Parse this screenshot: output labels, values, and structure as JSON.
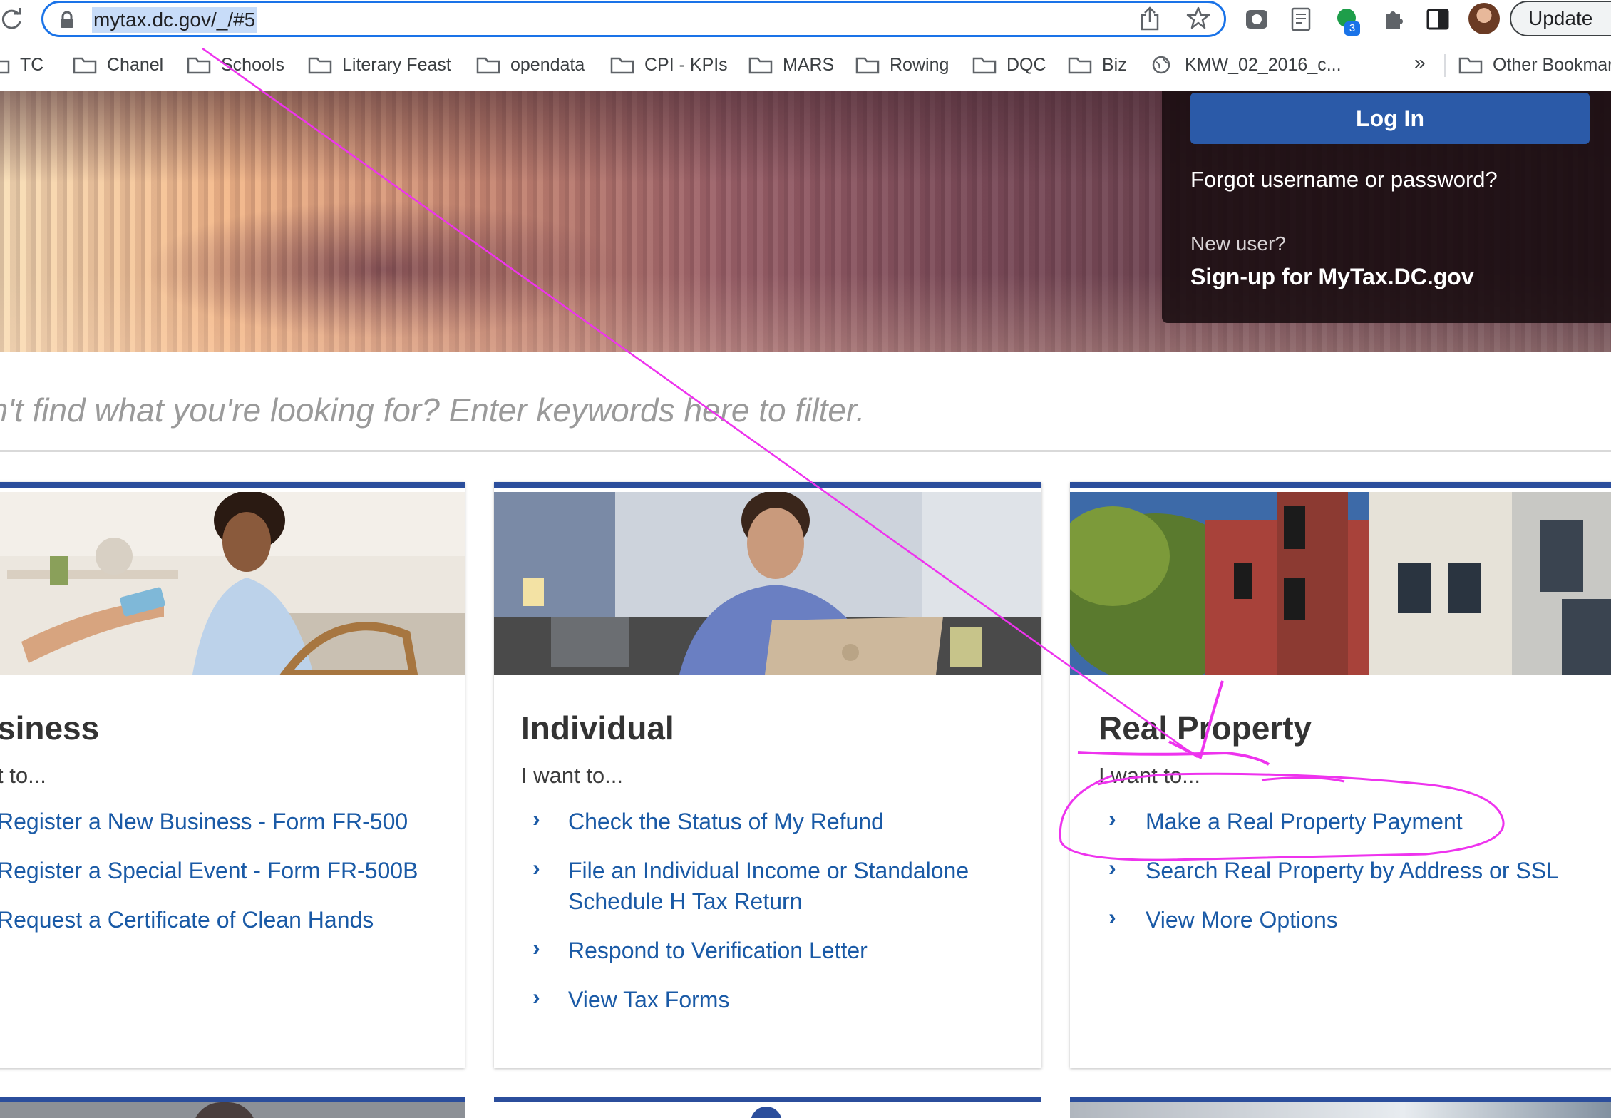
{
  "browser": {
    "url": "mytax.dc.gov/_/#5",
    "extension_badge": "3",
    "update_label": "Update"
  },
  "bookmarks": {
    "items": [
      "TC",
      "Chanel",
      "Schools",
      "Literary Feast",
      "opendata",
      "CPI - KPIs",
      "MARS",
      "Rowing",
      "DQC",
      "Biz",
      "KMW_02_2016_c..."
    ],
    "overflow": "»",
    "other": "Other Bookmar"
  },
  "login": {
    "button": "Log In",
    "forgot": "Forgot username or password?",
    "new_user": "New user?",
    "signup": "Sign-up for MyTax.DC.gov"
  },
  "filter": {
    "placeholder": "an't find what you're looking for? Enter keywords here to filter."
  },
  "cards": [
    {
      "title": "siness",
      "subtitle": "t to...",
      "links": [
        "Register a New Business - Form FR-500",
        "Register a Special Event - Form FR-500B",
        "Request a Certificate of Clean Hands"
      ]
    },
    {
      "title": "Individual",
      "subtitle": "I want to...",
      "links": [
        "Check the Status of My Refund",
        "File an Individual Income or Standalone",
        "Schedule H Tax Return",
        "Respond to Verification Letter",
        "View Tax Forms"
      ]
    },
    {
      "title": "Real Property",
      "subtitle": "I want to...",
      "links": [
        "Make a Real Property Payment",
        "Search Real Property by Address or SSL",
        "View More Options"
      ]
    }
  ],
  "colors": {
    "accent": "#2b4e9c",
    "link": "#1a5aa6",
    "annotation": "#ee33ee"
  }
}
